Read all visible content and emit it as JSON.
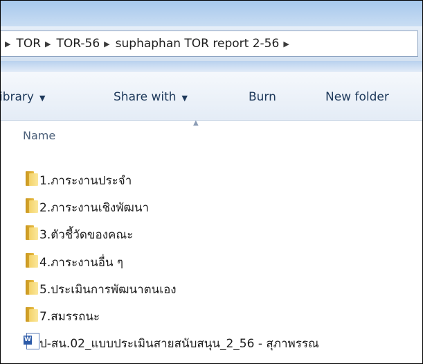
{
  "address": {
    "crumbs": [
      "TOR",
      "TOR-56",
      "suphaphan TOR report 2-56"
    ]
  },
  "toolbar": {
    "library_label": "ibrary",
    "share_label": "Share with",
    "burn_label": "Burn",
    "new_folder_label": "New folder"
  },
  "columns": {
    "name_label": "Name"
  },
  "files": [
    {
      "name": "1.ภาระงานประจำ",
      "type": "folder"
    },
    {
      "name": "2.ภาระงานเชิงพัฒนา",
      "type": "folder"
    },
    {
      "name": "3.ตัวชี้วัดของคณะ",
      "type": "folder"
    },
    {
      "name": "4.ภาระงานอื่น ๆ",
      "type": "folder"
    },
    {
      "name": "5.ประเมินการพัฒนาตนเอง",
      "type": "folder"
    },
    {
      "name": "7.สมรรถนะ",
      "type": "folder"
    },
    {
      "name": "ป-สน.02_แบบประเมินสายสนับสนุน_2_56 - สุภาพรรณ",
      "type": "word-document"
    }
  ]
}
